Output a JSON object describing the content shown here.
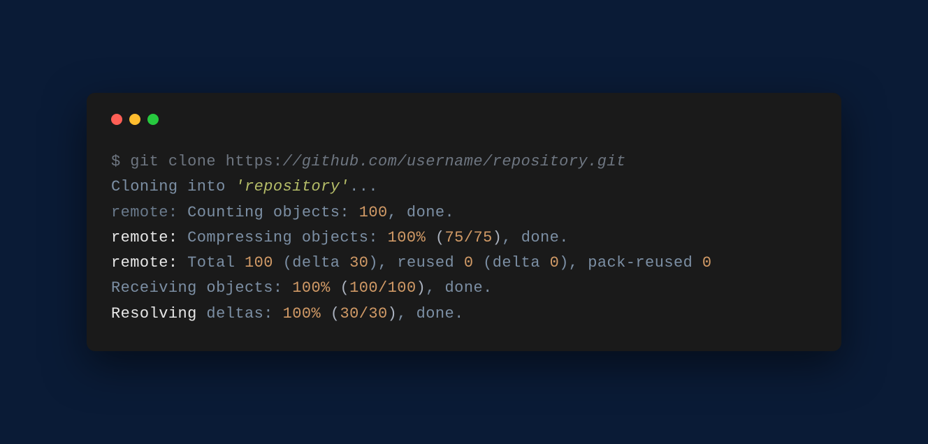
{
  "terminal": {
    "line1": {
      "prompt": "$ git clone https:",
      "url": "//github.com/username/repository.git"
    },
    "line2": {
      "part1": "Cloning into ",
      "repo": "'repository'",
      "part2": "..."
    },
    "line3": {
      "prefix": "remote: ",
      "label": "Counting objects: ",
      "num": "100",
      "suffix": ", done."
    },
    "line4": {
      "prefix": "remote: ",
      "label": "Compressing objects: ",
      "pct": "100%",
      "space": " ",
      "lparen": "(",
      "frac": "75/75",
      "rparen": ")",
      "suffix": ", done."
    },
    "line5": {
      "prefix": "remote: ",
      "total_label": "Total ",
      "total_num": "100",
      "delta_label": " (delta ",
      "delta_num": "30",
      "delta_close": ")",
      "reused_label": ", reused ",
      "reused_num": "0",
      "reused_delta": " (delta ",
      "reused_delta_num": "0",
      "reused_close": ")",
      "pack_label": ", pack-reused ",
      "pack_num": "0"
    },
    "line6": {
      "label": "Receiving objects: ",
      "pct": "100%",
      "space": " ",
      "lparen": "(",
      "frac": "100/100",
      "rparen": ")",
      "suffix": ", done."
    },
    "line7": {
      "prefix": "Resolving ",
      "label": "deltas: ",
      "pct": "100%",
      "space": " ",
      "lparen": "(",
      "frac": "30/30",
      "rparen": ")",
      "suffix": ", done."
    }
  }
}
